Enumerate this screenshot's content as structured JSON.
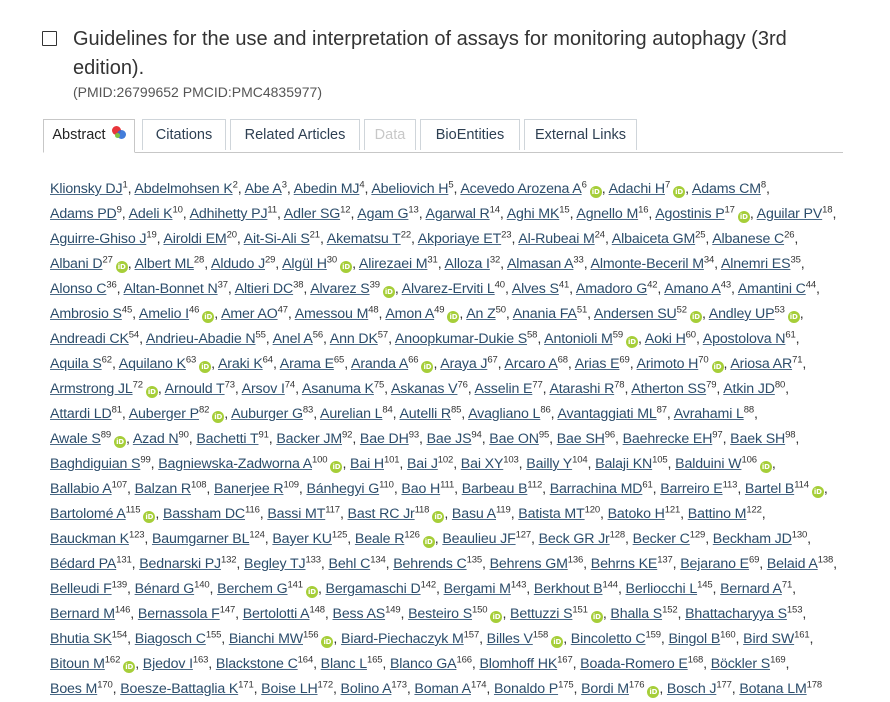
{
  "article": {
    "title": "Guidelines for the use and interpretation of assays for monitoring autophagy (3rd edition).",
    "ids": "(PMID:26799652 PMCID:PMC4835977)"
  },
  "tabs": [
    {
      "label": "Abstract",
      "active": true,
      "disabled": false
    },
    {
      "label": "Citations",
      "active": false,
      "disabled": false
    },
    {
      "label": "Related Articles",
      "active": false,
      "disabled": false
    },
    {
      "label": "Data",
      "active": false,
      "disabled": true
    },
    {
      "label": "BioEntities",
      "active": false,
      "disabled": false
    },
    {
      "label": "External Links",
      "active": false,
      "disabled": false
    }
  ],
  "colors": {
    "link": "#2c4d6b",
    "orcid": "#a6ce39",
    "tab_border": "#c7c7c7"
  },
  "authors": [
    {
      "n": "Klionsky DJ",
      "a": "1",
      "o": false
    },
    {
      "n": "Abdelmohsen K",
      "a": "2",
      "o": false
    },
    {
      "n": "Abe A",
      "a": "3",
      "o": false
    },
    {
      "n": "Abedin MJ",
      "a": "4",
      "o": false
    },
    {
      "n": "Abeliovich H",
      "a": "5",
      "o": false
    },
    {
      "n": "Acevedo Arozena A",
      "a": "6",
      "o": true
    },
    {
      "n": "Adachi H",
      "a": "7",
      "o": true
    },
    {
      "n": "Adams CM",
      "a": "8",
      "o": false
    },
    {
      "n": "Adams PD",
      "a": "9",
      "o": false
    },
    {
      "n": "Adeli K",
      "a": "10",
      "o": false
    },
    {
      "n": "Adhihetty PJ",
      "a": "11",
      "o": false
    },
    {
      "n": "Adler SG",
      "a": "12",
      "o": false
    },
    {
      "n": "Agam G",
      "a": "13",
      "o": false
    },
    {
      "n": "Agarwal R",
      "a": "14",
      "o": false
    },
    {
      "n": "Aghi MK",
      "a": "15",
      "o": false
    },
    {
      "n": "Agnello M",
      "a": "16",
      "o": false
    },
    {
      "n": "Agostinis P",
      "a": "17",
      "o": true
    },
    {
      "n": "Aguilar PV",
      "a": "18",
      "o": false
    },
    {
      "n": "Aguirre-Ghiso J",
      "a": "19",
      "o": false
    },
    {
      "n": "Airoldi EM",
      "a": "20",
      "o": false
    },
    {
      "n": "Ait-Si-Ali S",
      "a": "21",
      "o": false
    },
    {
      "n": "Akematsu T",
      "a": "22",
      "o": false
    },
    {
      "n": "Akporiaye ET",
      "a": "23",
      "o": false
    },
    {
      "n": "Al-Rubeai M",
      "a": "24",
      "o": false
    },
    {
      "n": "Albaiceta GM",
      "a": "25",
      "o": false
    },
    {
      "n": "Albanese C",
      "a": "26",
      "o": false
    },
    {
      "n": "Albani D",
      "a": "27",
      "o": true
    },
    {
      "n": "Albert ML",
      "a": "28",
      "o": false
    },
    {
      "n": "Aldudo J",
      "a": "29",
      "o": false
    },
    {
      "n": "Algül H",
      "a": "30",
      "o": true
    },
    {
      "n": "Alirezaei M",
      "a": "31",
      "o": false
    },
    {
      "n": "Alloza I",
      "a": "32",
      "o": false
    },
    {
      "n": "Almasan A",
      "a": "33",
      "o": false
    },
    {
      "n": "Almonte-Beceril M",
      "a": "34",
      "o": false
    },
    {
      "n": "Alnemri ES",
      "a": "35",
      "o": false
    },
    {
      "n": "Alonso C",
      "a": "36",
      "o": false
    },
    {
      "n": "Altan-Bonnet N",
      "a": "37",
      "o": false
    },
    {
      "n": "Altieri DC",
      "a": "38",
      "o": false
    },
    {
      "n": "Alvarez S",
      "a": "39",
      "o": true
    },
    {
      "n": "Alvarez-Erviti L",
      "a": "40",
      "o": false
    },
    {
      "n": "Alves S",
      "a": "41",
      "o": false
    },
    {
      "n": "Amadoro G",
      "a": "42",
      "o": false
    },
    {
      "n": "Amano A",
      "a": "43",
      "o": false
    },
    {
      "n": "Amantini C",
      "a": "44",
      "o": false
    },
    {
      "n": "Ambrosio S",
      "a": "45",
      "o": false
    },
    {
      "n": "Amelio I",
      "a": "46",
      "o": true
    },
    {
      "n": "Amer AO",
      "a": "47",
      "o": false
    },
    {
      "n": "Amessou M",
      "a": "48",
      "o": false
    },
    {
      "n": "Amon A",
      "a": "49",
      "o": true
    },
    {
      "n": "An Z",
      "a": "50",
      "o": false
    },
    {
      "n": "Anania FA",
      "a": "51",
      "o": false
    },
    {
      "n": "Andersen SU",
      "a": "52",
      "o": true
    },
    {
      "n": "Andley UP",
      "a": "53",
      "o": true
    },
    {
      "n": "Andreadi CK",
      "a": "54",
      "o": false
    },
    {
      "n": "Andrieu-Abadie N",
      "a": "55",
      "o": false
    },
    {
      "n": "Anel A",
      "a": "56",
      "o": false
    },
    {
      "n": "Ann DK",
      "a": "57",
      "o": false
    },
    {
      "n": "Anoopkumar-Dukie S",
      "a": "58",
      "o": false
    },
    {
      "n": "Antonioli M",
      "a": "59",
      "o": true
    },
    {
      "n": "Aoki H",
      "a": "60",
      "o": false
    },
    {
      "n": "Apostolova N",
      "a": "61",
      "o": false
    },
    {
      "n": "Aquila S",
      "a": "62",
      "o": false
    },
    {
      "n": "Aquilano K",
      "a": "63",
      "o": true
    },
    {
      "n": "Araki K",
      "a": "64",
      "o": false
    },
    {
      "n": "Arama E",
      "a": "65",
      "o": false
    },
    {
      "n": "Aranda A",
      "a": "66",
      "o": true
    },
    {
      "n": "Araya J",
      "a": "67",
      "o": false
    },
    {
      "n": "Arcaro A",
      "a": "68",
      "o": false
    },
    {
      "n": "Arias E",
      "a": "69",
      "o": false
    },
    {
      "n": "Arimoto H",
      "a": "70",
      "o": true
    },
    {
      "n": "Ariosa AR",
      "a": "71",
      "o": false
    },
    {
      "n": "Armstrong JL",
      "a": "72",
      "o": true
    },
    {
      "n": "Arnould T",
      "a": "73",
      "o": false
    },
    {
      "n": "Arsov I",
      "a": "74",
      "o": false
    },
    {
      "n": "Asanuma K",
      "a": "75",
      "o": false
    },
    {
      "n": "Askanas V",
      "a": "76",
      "o": false
    },
    {
      "n": "Asselin E",
      "a": "77",
      "o": false
    },
    {
      "n": "Atarashi R",
      "a": "78",
      "o": false
    },
    {
      "n": "Atherton SS",
      "a": "79",
      "o": false
    },
    {
      "n": "Atkin JD",
      "a": "80",
      "o": false
    },
    {
      "n": "Attardi LD",
      "a": "81",
      "o": false
    },
    {
      "n": "Auberger P",
      "a": "82",
      "o": true
    },
    {
      "n": "Auburger G",
      "a": "83",
      "o": false
    },
    {
      "n": "Aurelian L",
      "a": "84",
      "o": false
    },
    {
      "n": "Autelli R",
      "a": "85",
      "o": false
    },
    {
      "n": "Avagliano L",
      "a": "86",
      "o": false
    },
    {
      "n": "Avantaggiati ML",
      "a": "87",
      "o": false
    },
    {
      "n": "Avrahami L",
      "a": "88",
      "o": false
    },
    {
      "n": "Awale S",
      "a": "89",
      "o": true
    },
    {
      "n": "Azad N",
      "a": "90",
      "o": false
    },
    {
      "n": "Bachetti T",
      "a": "91",
      "o": false
    },
    {
      "n": "Backer JM",
      "a": "92",
      "o": false
    },
    {
      "n": "Bae DH",
      "a": "93",
      "o": false
    },
    {
      "n": "Bae JS",
      "a": "94",
      "o": false
    },
    {
      "n": "Bae ON",
      "a": "95",
      "o": false
    },
    {
      "n": "Bae SH",
      "a": "96",
      "o": false
    },
    {
      "n": "Baehrecke EH",
      "a": "97",
      "o": false
    },
    {
      "n": "Baek SH",
      "a": "98",
      "o": false
    },
    {
      "n": "Baghdiguian S",
      "a": "99",
      "o": false
    },
    {
      "n": "Bagniewska-Zadworna A",
      "a": "100",
      "o": true
    },
    {
      "n": "Bai H",
      "a": "101",
      "o": false
    },
    {
      "n": "Bai J",
      "a": "102",
      "o": false
    },
    {
      "n": "Bai XY",
      "a": "103",
      "o": false
    },
    {
      "n": "Bailly Y",
      "a": "104",
      "o": false
    },
    {
      "n": "Balaji KN",
      "a": "105",
      "o": false
    },
    {
      "n": "Balduini W",
      "a": "106",
      "o": true
    },
    {
      "n": "Ballabio A",
      "a": "107",
      "o": false
    },
    {
      "n": "Balzan R",
      "a": "108",
      "o": false
    },
    {
      "n": "Banerjee R",
      "a": "109",
      "o": false
    },
    {
      "n": "Bánhegyi G",
      "a": "110",
      "o": false
    },
    {
      "n": "Bao H",
      "a": "111",
      "o": false
    },
    {
      "n": "Barbeau B",
      "a": "112",
      "o": false
    },
    {
      "n": "Barrachina MD",
      "a": "61",
      "o": false
    },
    {
      "n": "Barreiro E",
      "a": "113",
      "o": false
    },
    {
      "n": "Bartel B",
      "a": "114",
      "o": true
    },
    {
      "n": "Bartolomé A",
      "a": "115",
      "o": true
    },
    {
      "n": "Bassham DC",
      "a": "116",
      "o": false
    },
    {
      "n": "Bassi MT",
      "a": "117",
      "o": false
    },
    {
      "n": "Bast RC Jr",
      "a": "118",
      "o": true
    },
    {
      "n": "Basu A",
      "a": "119",
      "o": false
    },
    {
      "n": "Batista MT",
      "a": "120",
      "o": false
    },
    {
      "n": "Batoko H",
      "a": "121",
      "o": false
    },
    {
      "n": "Battino M",
      "a": "122",
      "o": false
    },
    {
      "n": "Bauckman K",
      "a": "123",
      "o": false
    },
    {
      "n": "Baumgarner BL",
      "a": "124",
      "o": false
    },
    {
      "n": "Bayer KU",
      "a": "125",
      "o": false
    },
    {
      "n": "Beale R",
      "a": "126",
      "o": true
    },
    {
      "n": "Beaulieu JF",
      "a": "127",
      "o": false
    },
    {
      "n": "Beck GR Jr",
      "a": "128",
      "o": false
    },
    {
      "n": "Becker C",
      "a": "129",
      "o": false
    },
    {
      "n": "Beckham JD",
      "a": "130",
      "o": false
    },
    {
      "n": "Bédard PA",
      "a": "131",
      "o": false
    },
    {
      "n": "Bednarski PJ",
      "a": "132",
      "o": false
    },
    {
      "n": "Begley TJ",
      "a": "133",
      "o": false
    },
    {
      "n": "Behl C",
      "a": "134",
      "o": false
    },
    {
      "n": "Behrends C",
      "a": "135",
      "o": false
    },
    {
      "n": "Behrens GM",
      "a": "136",
      "o": false
    },
    {
      "n": "Behrns KE",
      "a": "137",
      "o": false
    },
    {
      "n": "Bejarano E",
      "a": "69",
      "o": false
    },
    {
      "n": "Belaid A",
      "a": "138",
      "o": false
    },
    {
      "n": "Belleudi F",
      "a": "139",
      "o": false
    },
    {
      "n": "Bénard G",
      "a": "140",
      "o": false
    },
    {
      "n": "Berchem G",
      "a": "141",
      "o": true
    },
    {
      "n": "Bergamaschi D",
      "a": "142",
      "o": false
    },
    {
      "n": "Bergami M",
      "a": "143",
      "o": false
    },
    {
      "n": "Berkhout B",
      "a": "144",
      "o": false
    },
    {
      "n": "Berliocchi L",
      "a": "145",
      "o": false
    },
    {
      "n": "Bernard A",
      "a": "71",
      "o": false
    },
    {
      "n": "Bernard M",
      "a": "146",
      "o": false
    },
    {
      "n": "Bernassola F",
      "a": "147",
      "o": false
    },
    {
      "n": "Bertolotti A",
      "a": "148",
      "o": false
    },
    {
      "n": "Bess AS",
      "a": "149",
      "o": false
    },
    {
      "n": "Besteiro S",
      "a": "150",
      "o": true
    },
    {
      "n": "Bettuzzi S",
      "a": "151",
      "o": true
    },
    {
      "n": "Bhalla S",
      "a": "152",
      "o": false
    },
    {
      "n": "Bhattacharyya S",
      "a": "153",
      "o": false
    },
    {
      "n": "Bhutia SK",
      "a": "154",
      "o": false
    },
    {
      "n": "Biagosch C",
      "a": "155",
      "o": false
    },
    {
      "n": "Bianchi MW",
      "a": "156",
      "o": true
    },
    {
      "n": "Biard-Piechaczyk M",
      "a": "157",
      "o": false
    },
    {
      "n": "Billes V",
      "a": "158",
      "o": true
    },
    {
      "n": "Bincoletto C",
      "a": "159",
      "o": false
    },
    {
      "n": "Bingol B",
      "a": "160",
      "o": false
    },
    {
      "n": "Bird SW",
      "a": "161",
      "o": false
    },
    {
      "n": "Bitoun M",
      "a": "162",
      "o": true
    },
    {
      "n": "Bjedov I",
      "a": "163",
      "o": false
    },
    {
      "n": "Blackstone C",
      "a": "164",
      "o": false
    },
    {
      "n": "Blanc L",
      "a": "165",
      "o": false
    },
    {
      "n": "Blanco GA",
      "a": "166",
      "o": false
    },
    {
      "n": "Blomhoff HK",
      "a": "167",
      "o": false
    },
    {
      "n": "Boada-Romero E",
      "a": "168",
      "o": false
    },
    {
      "n": "Böckler S",
      "a": "169",
      "o": false
    },
    {
      "n": "Boes M",
      "a": "170",
      "o": false
    },
    {
      "n": "Boesze-Battaglia K",
      "a": "171",
      "o": false
    },
    {
      "n": "Boise LH",
      "a": "172",
      "o": false
    },
    {
      "n": "Bolino A",
      "a": "173",
      "o": false
    },
    {
      "n": "Boman A",
      "a": "174",
      "o": false
    },
    {
      "n": "Bonaldo P",
      "a": "175",
      "o": false
    },
    {
      "n": "Bordi M",
      "a": "176",
      "o": true
    },
    {
      "n": "Bosch J",
      "a": "177",
      "o": false
    },
    {
      "n": "Botana LM",
      "a": "178",
      "o": false
    }
  ]
}
